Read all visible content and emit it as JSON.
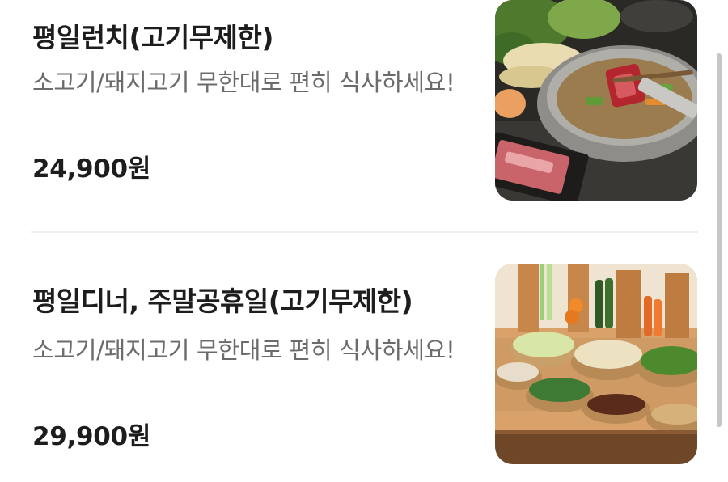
{
  "menu": {
    "items": [
      {
        "name": "평일런치(고기무제한)",
        "description": "소고기/돼지고기 무한대로 편히 식사하세요!",
        "price": "24,900원",
        "image": "hot-pot-shabu-shabu-photo"
      },
      {
        "name": "평일디너, 주말공휴일(고기무제한)",
        "description": "소고기/돼지고기 무한대로 편히 식사하세요!",
        "price": "29,900원",
        "image": "vegetable-buffet-bar-photo"
      }
    ]
  },
  "colors": {
    "title": "#1d1d1d",
    "description": "#6b6b6b",
    "divider": "#efefef",
    "scrollbar": "#c7c7c7"
  }
}
